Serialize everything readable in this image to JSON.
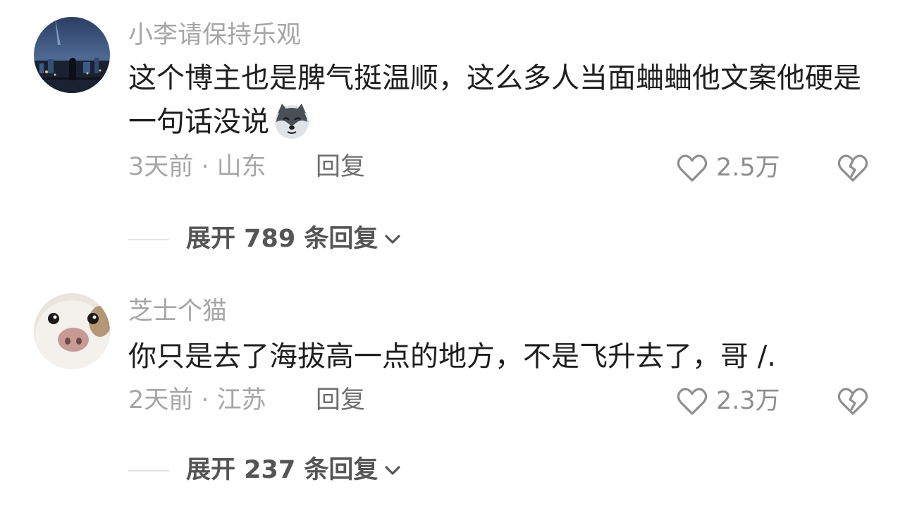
{
  "comments": [
    {
      "username": "小李请保持乐观",
      "text": "这个博主也是脾气挺温顺，这么多人当面蛐蛐他文案他硬是一句话没说",
      "emoji_icon": "husky-dog-emoji",
      "time_location": "3天前 · 山东",
      "reply_label": "回复",
      "likes": "2.5万",
      "expand_label": "展开 789 条回复"
    },
    {
      "username": "芝士个猫",
      "text": "你只是去了海拔高一点的地方，不是飞升去了，哥 /.",
      "time_location": "2天前 · 江苏",
      "reply_label": "回复",
      "likes": "2.3万",
      "expand_label": "展开 237 条回复"
    }
  ],
  "icons": {
    "like": "heart-outline-icon",
    "dislike": "broken-heart-icon",
    "expand": "chevron-down-icon"
  },
  "colors": {
    "username": "#a6a6a6",
    "text": "#1e1e1e",
    "meta": "#a6a6a6",
    "reply": "#6e6e6e",
    "expand": "#555555"
  }
}
